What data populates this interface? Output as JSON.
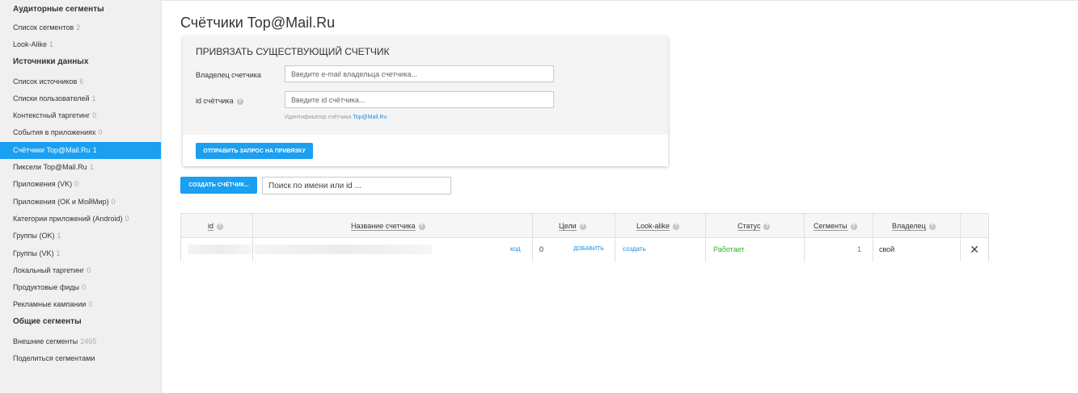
{
  "sidebar": {
    "groups": [
      {
        "title": "Аудиторные сегменты",
        "items": [
          {
            "label": "Список сегментов",
            "count": "2"
          },
          {
            "label": "Look-Alike",
            "count": "1"
          }
        ]
      },
      {
        "title": "Источники данных",
        "items": [
          {
            "label": "Список источников",
            "count": "6"
          },
          {
            "label": "Списки пользователей",
            "count": "1"
          },
          {
            "label": "Контекстный таргетинг",
            "count": "0"
          },
          {
            "label": "События в приложениях",
            "count": "0"
          },
          {
            "label": "Счётчики Top@Mail.Ru",
            "count": "1",
            "active": true
          },
          {
            "label": "Пиксели Top@Mail.Ru",
            "count": "1"
          },
          {
            "label": "Приложения (VK)",
            "count": "0"
          },
          {
            "label": "Приложения (ОК и МойМир)",
            "count": "0"
          },
          {
            "label": "Категории приложений (Android)",
            "count": "0"
          },
          {
            "label": "Группы (OK)",
            "count": "1"
          },
          {
            "label": "Группы (VK)",
            "count": "1"
          },
          {
            "label": "Локальный таргетинг",
            "count": "0"
          },
          {
            "label": "Продуктовые фиды",
            "count": "0"
          },
          {
            "label": "Рекламные кампании",
            "count": "0"
          }
        ]
      },
      {
        "title": "Общие сегменты",
        "items": [
          {
            "label": "Внешние сегменты",
            "count": "2465"
          },
          {
            "label": "Поделиться сегментами",
            "count": ""
          }
        ]
      }
    ]
  },
  "page": {
    "title": "Счётчики Top@Mail.Ru"
  },
  "bind_panel": {
    "title": "ПРИВЯЗАТЬ СУЩЕСТВУЮЩИЙ СЧЕТЧИК",
    "owner_label": "Владелец счетчика",
    "owner_placeholder": "Введите e-mail владельца счетчика...",
    "id_label": "id счётчика",
    "id_placeholder": "Введите id счётчика...",
    "hint_text": "Идентификатор счётчика ",
    "hint_link": "Top@Mail.Ru",
    "send_button": "ОТПРАВИТЬ ЗАПРОС НА ПРИВЯЗКУ"
  },
  "toolbar": {
    "create_button": "СОЗДАТЬ СЧЁТЧИК...",
    "search_placeholder": "Поиск по имени или id ..."
  },
  "table": {
    "headers": {
      "id": "id",
      "name": "Название счетчика",
      "goals": "Цели",
      "lookalike": "Look-alike",
      "status": "Статус",
      "segments": "Сегменты",
      "owner": "Владелец"
    },
    "rows": [
      {
        "code_link": "код",
        "goals_count": "0",
        "goals_add": "ДОБАВИТЬ",
        "lookalike": "создать",
        "status": "Работает",
        "segments": "1",
        "owner": "свой"
      }
    ]
  },
  "colors": {
    "accent": "#1a9ff1",
    "link": "#1a8fe0",
    "status_ok": "#2ab52a"
  }
}
